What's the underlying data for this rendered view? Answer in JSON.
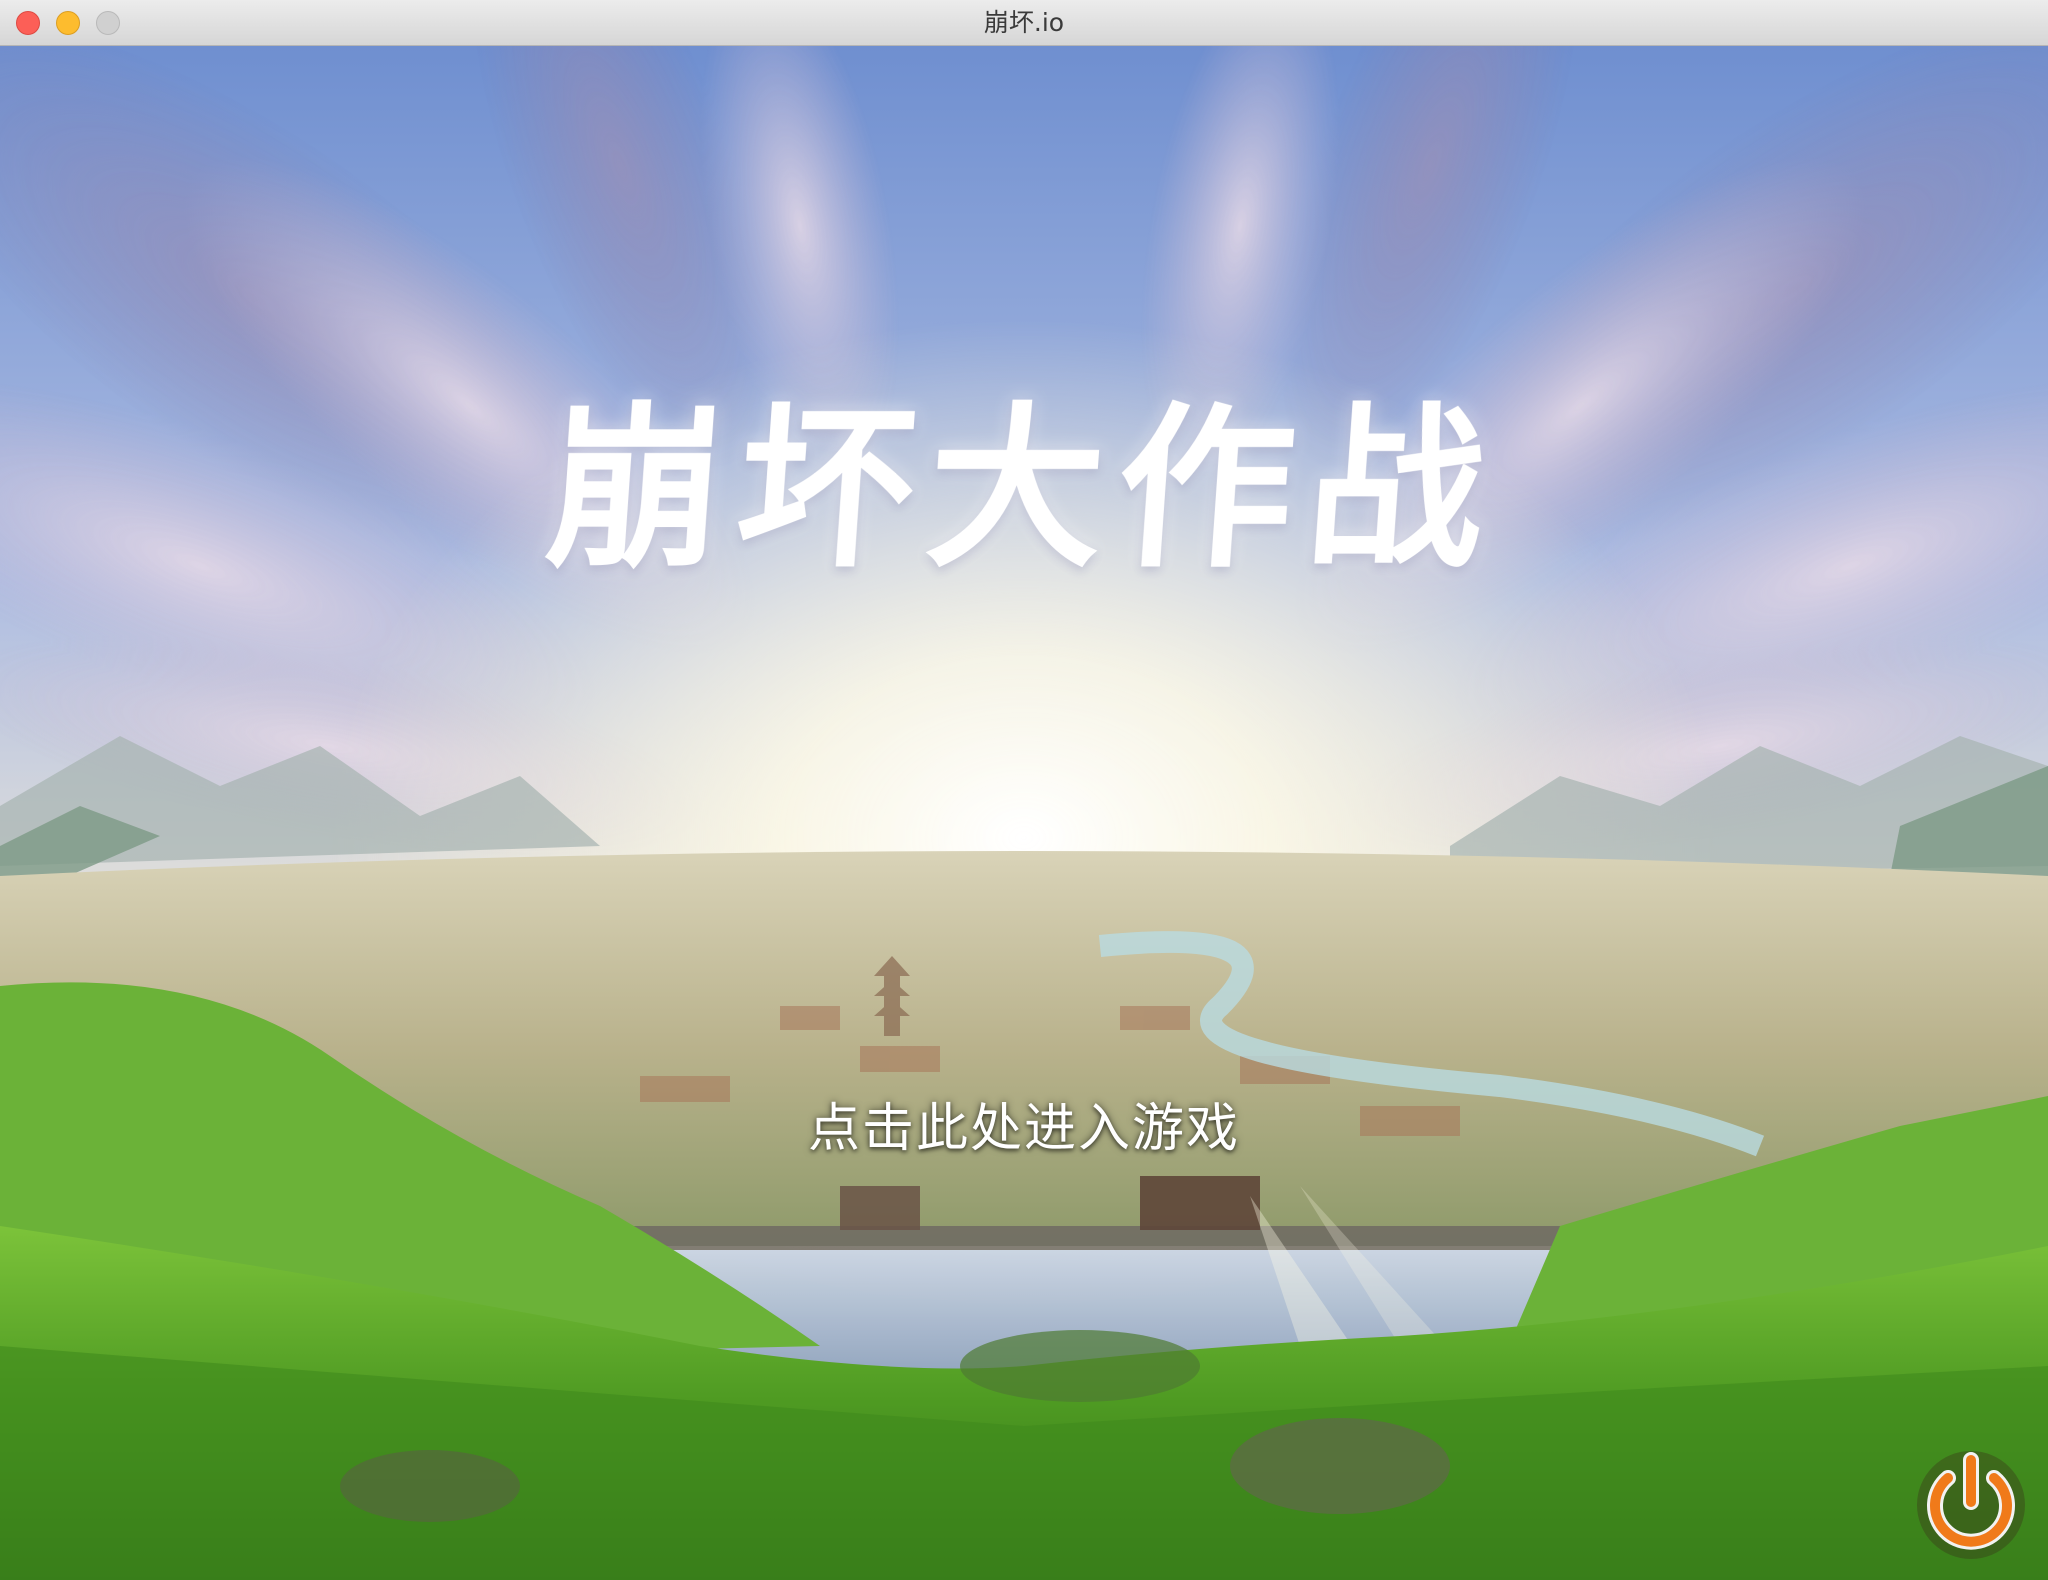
{
  "window": {
    "title": "崩坏.io"
  },
  "game": {
    "title": "崩坏大作战",
    "enter_prompt": "点击此处进入游戏",
    "power_icon": "power-icon"
  },
  "colors": {
    "sky_top": "#6f8fd0",
    "horizon_glow": "#fff6dc",
    "grass": "#5ea82a",
    "power_orange": "#f07a1a"
  }
}
